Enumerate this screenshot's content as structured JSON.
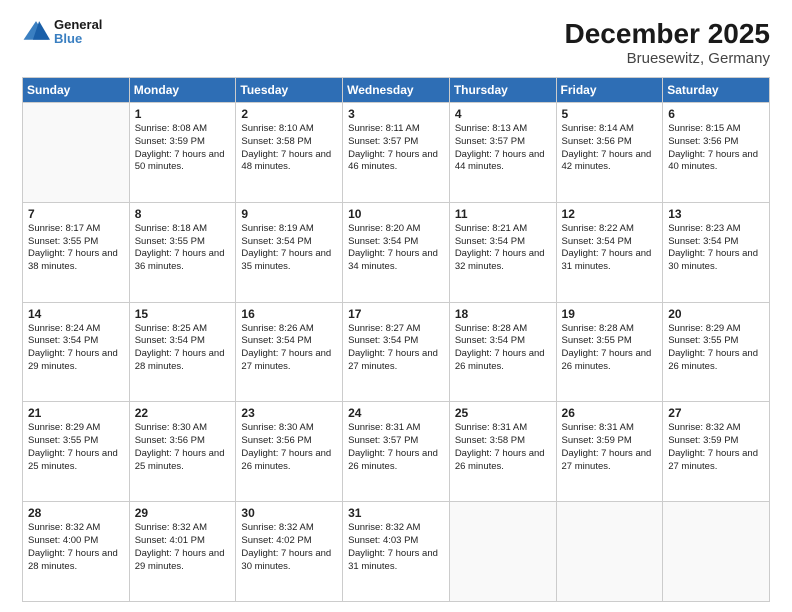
{
  "logo": {
    "line1": "General",
    "line2": "Blue"
  },
  "title": "December 2025",
  "subtitle": "Bruesewitz, Germany",
  "days": [
    "Sunday",
    "Monday",
    "Tuesday",
    "Wednesday",
    "Thursday",
    "Friday",
    "Saturday"
  ],
  "weeks": [
    [
      {
        "num": "",
        "empty": true
      },
      {
        "num": "1",
        "sunrise": "8:08 AM",
        "sunset": "3:59 PM",
        "daylight": "7 hours and 50 minutes."
      },
      {
        "num": "2",
        "sunrise": "8:10 AM",
        "sunset": "3:58 PM",
        "daylight": "7 hours and 48 minutes."
      },
      {
        "num": "3",
        "sunrise": "8:11 AM",
        "sunset": "3:57 PM",
        "daylight": "7 hours and 46 minutes."
      },
      {
        "num": "4",
        "sunrise": "8:13 AM",
        "sunset": "3:57 PM",
        "daylight": "7 hours and 44 minutes."
      },
      {
        "num": "5",
        "sunrise": "8:14 AM",
        "sunset": "3:56 PM",
        "daylight": "7 hours and 42 minutes."
      },
      {
        "num": "6",
        "sunrise": "8:15 AM",
        "sunset": "3:56 PM",
        "daylight": "7 hours and 40 minutes."
      }
    ],
    [
      {
        "num": "7",
        "sunrise": "8:17 AM",
        "sunset": "3:55 PM",
        "daylight": "7 hours and 38 minutes."
      },
      {
        "num": "8",
        "sunrise": "8:18 AM",
        "sunset": "3:55 PM",
        "daylight": "7 hours and 36 minutes."
      },
      {
        "num": "9",
        "sunrise": "8:19 AM",
        "sunset": "3:54 PM",
        "daylight": "7 hours and 35 minutes."
      },
      {
        "num": "10",
        "sunrise": "8:20 AM",
        "sunset": "3:54 PM",
        "daylight": "7 hours and 34 minutes."
      },
      {
        "num": "11",
        "sunrise": "8:21 AM",
        "sunset": "3:54 PM",
        "daylight": "7 hours and 32 minutes."
      },
      {
        "num": "12",
        "sunrise": "8:22 AM",
        "sunset": "3:54 PM",
        "daylight": "7 hours and 31 minutes."
      },
      {
        "num": "13",
        "sunrise": "8:23 AM",
        "sunset": "3:54 PM",
        "daylight": "7 hours and 30 minutes."
      }
    ],
    [
      {
        "num": "14",
        "sunrise": "8:24 AM",
        "sunset": "3:54 PM",
        "daylight": "7 hours and 29 minutes."
      },
      {
        "num": "15",
        "sunrise": "8:25 AM",
        "sunset": "3:54 PM",
        "daylight": "7 hours and 28 minutes."
      },
      {
        "num": "16",
        "sunrise": "8:26 AM",
        "sunset": "3:54 PM",
        "daylight": "7 hours and 27 minutes."
      },
      {
        "num": "17",
        "sunrise": "8:27 AM",
        "sunset": "3:54 PM",
        "daylight": "7 hours and 27 minutes."
      },
      {
        "num": "18",
        "sunrise": "8:28 AM",
        "sunset": "3:54 PM",
        "daylight": "7 hours and 26 minutes."
      },
      {
        "num": "19",
        "sunrise": "8:28 AM",
        "sunset": "3:55 PM",
        "daylight": "7 hours and 26 minutes."
      },
      {
        "num": "20",
        "sunrise": "8:29 AM",
        "sunset": "3:55 PM",
        "daylight": "7 hours and 26 minutes."
      }
    ],
    [
      {
        "num": "21",
        "sunrise": "8:29 AM",
        "sunset": "3:55 PM",
        "daylight": "7 hours and 25 minutes."
      },
      {
        "num": "22",
        "sunrise": "8:30 AM",
        "sunset": "3:56 PM",
        "daylight": "7 hours and 25 minutes."
      },
      {
        "num": "23",
        "sunrise": "8:30 AM",
        "sunset": "3:56 PM",
        "daylight": "7 hours and 26 minutes."
      },
      {
        "num": "24",
        "sunrise": "8:31 AM",
        "sunset": "3:57 PM",
        "daylight": "7 hours and 26 minutes."
      },
      {
        "num": "25",
        "sunrise": "8:31 AM",
        "sunset": "3:58 PM",
        "daylight": "7 hours and 26 minutes."
      },
      {
        "num": "26",
        "sunrise": "8:31 AM",
        "sunset": "3:59 PM",
        "daylight": "7 hours and 27 minutes."
      },
      {
        "num": "27",
        "sunrise": "8:32 AM",
        "sunset": "3:59 PM",
        "daylight": "7 hours and 27 minutes."
      }
    ],
    [
      {
        "num": "28",
        "sunrise": "8:32 AM",
        "sunset": "4:00 PM",
        "daylight": "7 hours and 28 minutes."
      },
      {
        "num": "29",
        "sunrise": "8:32 AM",
        "sunset": "4:01 PM",
        "daylight": "7 hours and 29 minutes."
      },
      {
        "num": "30",
        "sunrise": "8:32 AM",
        "sunset": "4:02 PM",
        "daylight": "7 hours and 30 minutes."
      },
      {
        "num": "31",
        "sunrise": "8:32 AM",
        "sunset": "4:03 PM",
        "daylight": "7 hours and 31 minutes."
      },
      {
        "num": "",
        "empty": true
      },
      {
        "num": "",
        "empty": true
      },
      {
        "num": "",
        "empty": true
      }
    ]
  ]
}
